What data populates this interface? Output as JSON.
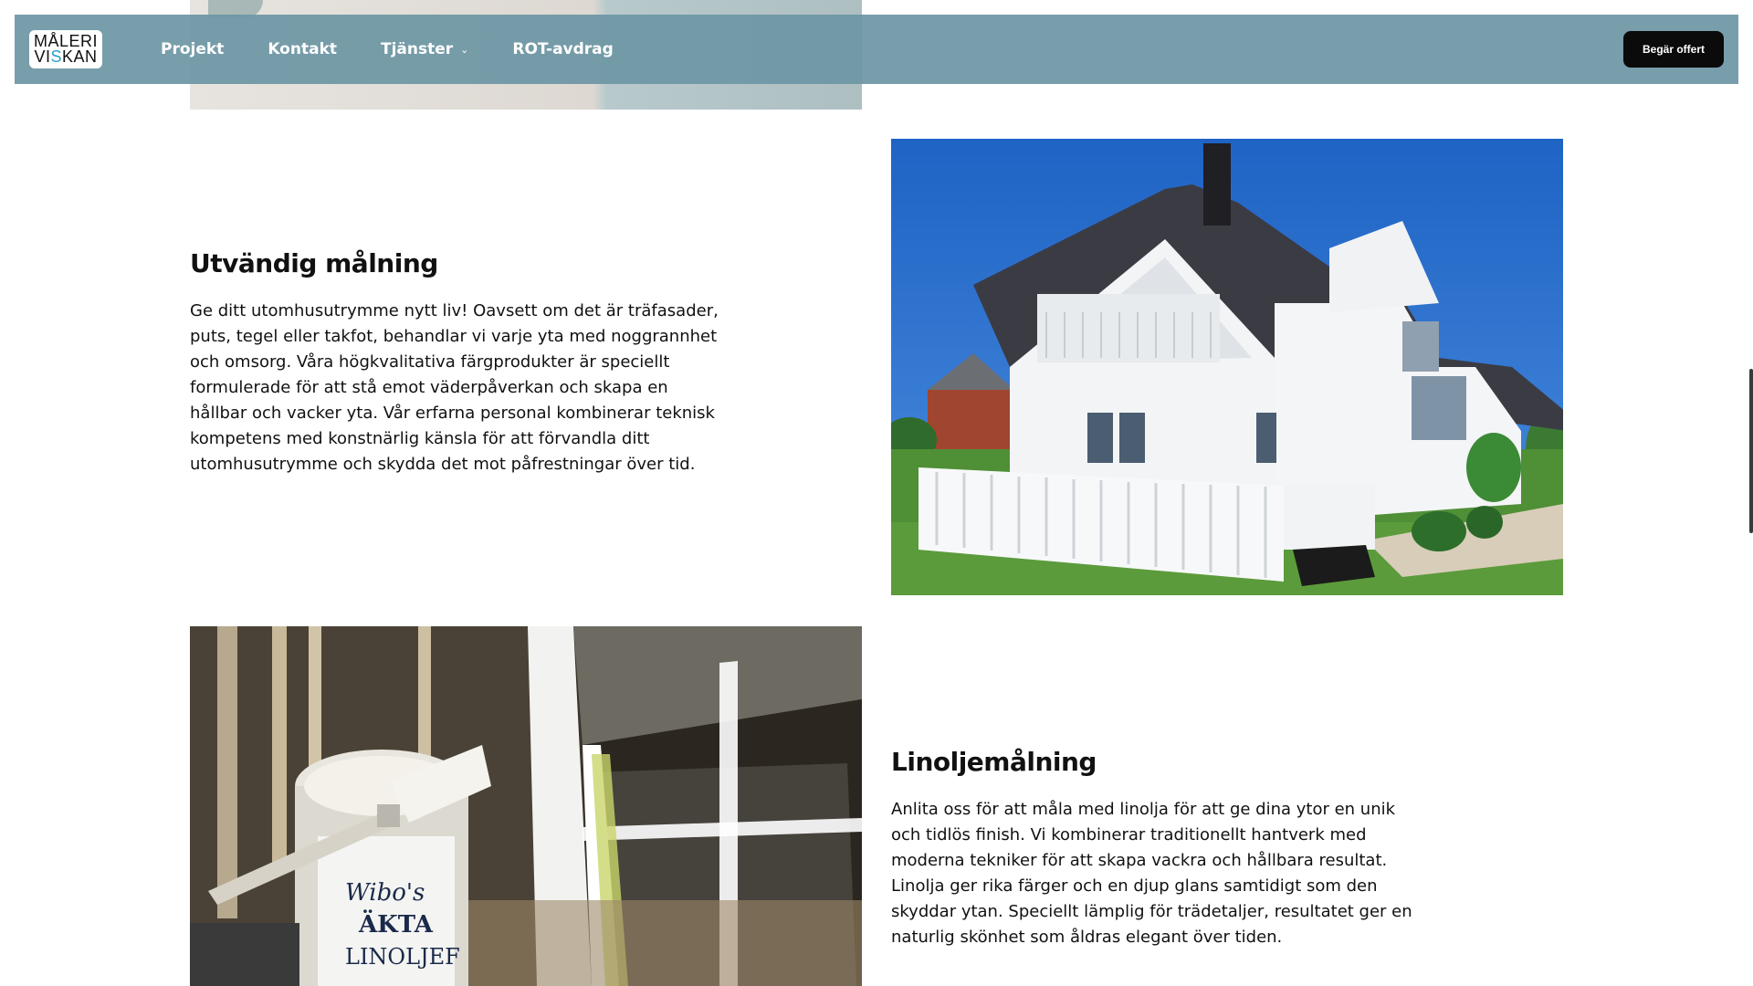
{
  "header": {
    "logo": {
      "line1": "MÅLERI",
      "line2_prefix": "VI",
      "line2_accent": "S",
      "line2_suffix": "KAN"
    },
    "nav": [
      {
        "label": "Projekt"
      },
      {
        "label": "Kontakt"
      },
      {
        "label": "Tjänster",
        "has_dropdown": true
      },
      {
        "label": "ROT-avdrag"
      }
    ],
    "cta_label": "Begär offert"
  },
  "sections": [
    {
      "title": "Utvändig målning",
      "body": "Ge ditt utomhusutrymme nytt liv! Oavsett om det är träfasader, puts, tegel eller takfot, behandlar vi varje yta med noggrannhet och omsorg. Våra högkvalitativa färgprodukter är speciellt formulerade för att stå emot väderpåverkan och skapa en hållbar och vacker yta. Vår erfarna personal kombinerar teknisk kompetens med konstnärlig känsla för att förvandla ditt utomhusutrymme och skydda det mot påfrestningar över tid.",
      "image": "white-house-photo"
    },
    {
      "title": "Linoljemålning",
      "body": "Anlita oss för att måla med linolja för att ge dina ytor en unik och tidlös finish. Vi kombinerar traditionellt hantverk med moderna tekniker för att skapa vackra och hållbara resultat. Linolja ger rika färger och en djup glans samtidigt som den skyddar ytan. Speciellt lämplig för trädetaljer, resultatet ger en naturlig skönhet som åldras elegant över tiden.",
      "image": "linseed-paint-window-photo",
      "can_label_line1": "Wibo's",
      "can_label_line2": "ÄKTA",
      "can_label_line3": "LINOLJEF"
    }
  ],
  "colors": {
    "navbar": "#6c96a4",
    "cta_bg": "#0b0b0b",
    "logo_accent": "#2a9fc7"
  }
}
